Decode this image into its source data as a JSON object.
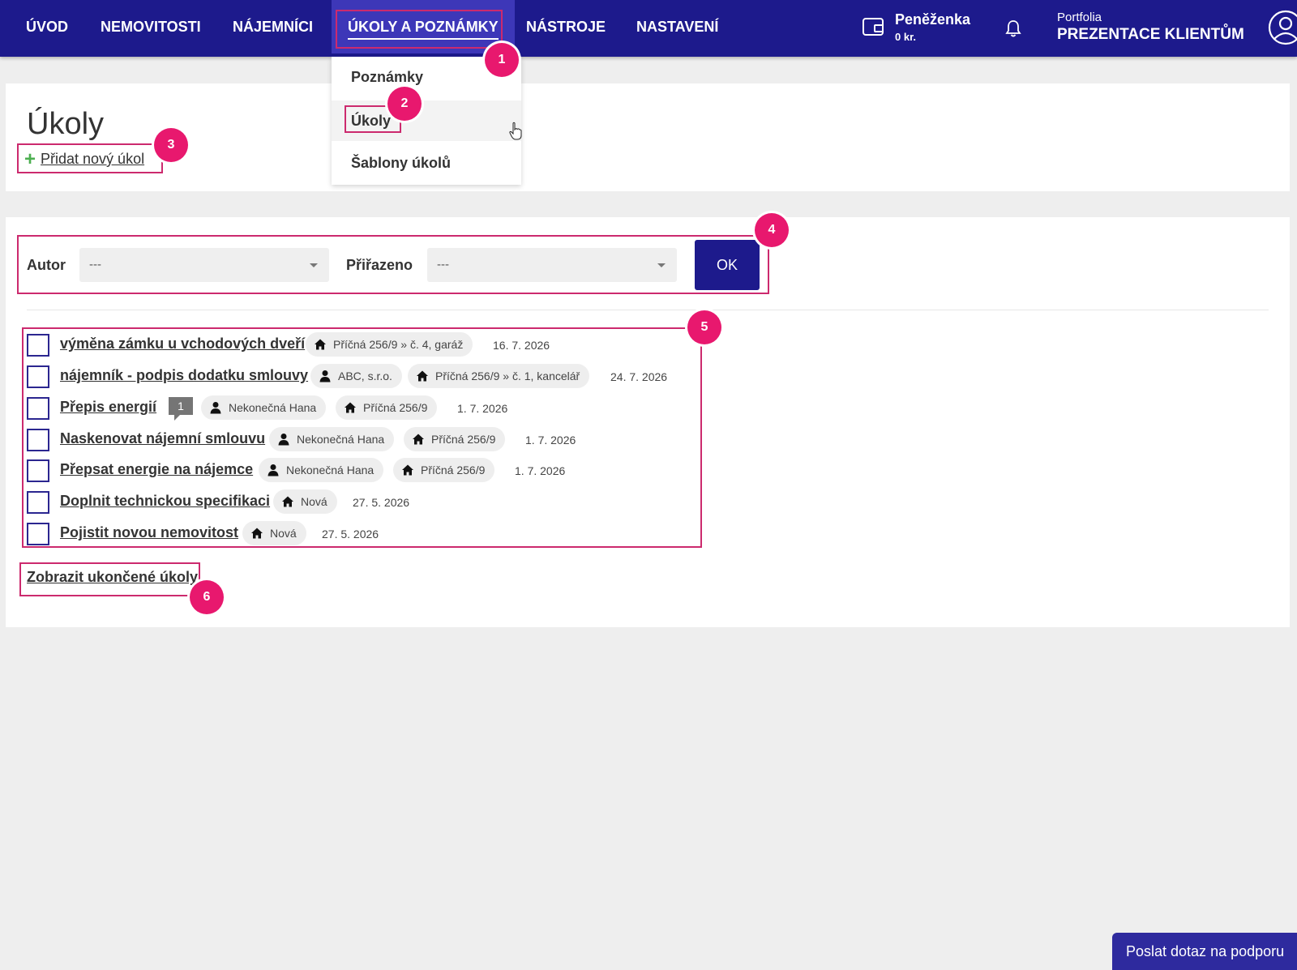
{
  "nav": {
    "items": [
      {
        "label": "ÚVOD"
      },
      {
        "label": "NEMOVITOSTI"
      },
      {
        "label": "NÁJEMNÍCI"
      },
      {
        "label": "ÚKOLY A POZNÁMKY"
      },
      {
        "label": "NÁSTROJE"
      },
      {
        "label": "NASTAVENÍ"
      }
    ],
    "wallet": {
      "title": "Peněženka",
      "amount": "0 kr."
    },
    "portfolio": {
      "label": "Portfolia",
      "name": "PREZENTACE KLIENTŮM"
    }
  },
  "dropdown": {
    "items": [
      {
        "label": "Poznámky"
      },
      {
        "label": "Úkoly"
      },
      {
        "label": "Šablony úkolů"
      }
    ]
  },
  "page": {
    "title": "Úkoly",
    "add_task": "Přidat nový úkol"
  },
  "filter": {
    "author_label": "Autor",
    "author_value": "---",
    "assigned_label": "Přiřazeno",
    "assigned_value": "---",
    "ok_label": "OK"
  },
  "tasks": [
    {
      "title": "výměna zámku u vchodových dveří",
      "property": "Příčná 256/9 » č. 4, garáž",
      "date": "16. 7. 2026"
    },
    {
      "title": "nájemník - podpis dodatku smlouvy",
      "person": "ABC, s.r.o.",
      "property": "Příčná 256/9 » č. 1, kancelář",
      "date": "24. 7. 2026"
    },
    {
      "title": "Přepis energií",
      "comments": "1",
      "person": "Nekonečná Hana",
      "property": "Příčná 256/9",
      "date": "1. 7. 2026"
    },
    {
      "title": "Naskenovat nájemní smlouvu",
      "person": "Nekonečná Hana",
      "property": "Příčná 256/9",
      "date": "1. 7. 2026"
    },
    {
      "title": "Přepsat energie na nájemce",
      "person": "Nekonečná Hana",
      "property": "Příčná 256/9",
      "date": "1. 7. 2026"
    },
    {
      "title": "Doplnit technickou specifikaci",
      "property": "Nová",
      "date": "27. 5. 2026"
    },
    {
      "title": "Pojistit novou nemovitost",
      "property": "Nová",
      "date": "27. 5. 2026"
    }
  ],
  "show_done": "Zobrazit ukončené úkoly",
  "annotations": [
    "1",
    "2",
    "3",
    "4",
    "5",
    "6"
  ],
  "support": "Poslat dotaz na podporu",
  "colors": {
    "nav_bg": "#1d1a8c",
    "highlight": "#cc2a6e",
    "badge": "#e8186e",
    "plus": "#4caf50"
  }
}
